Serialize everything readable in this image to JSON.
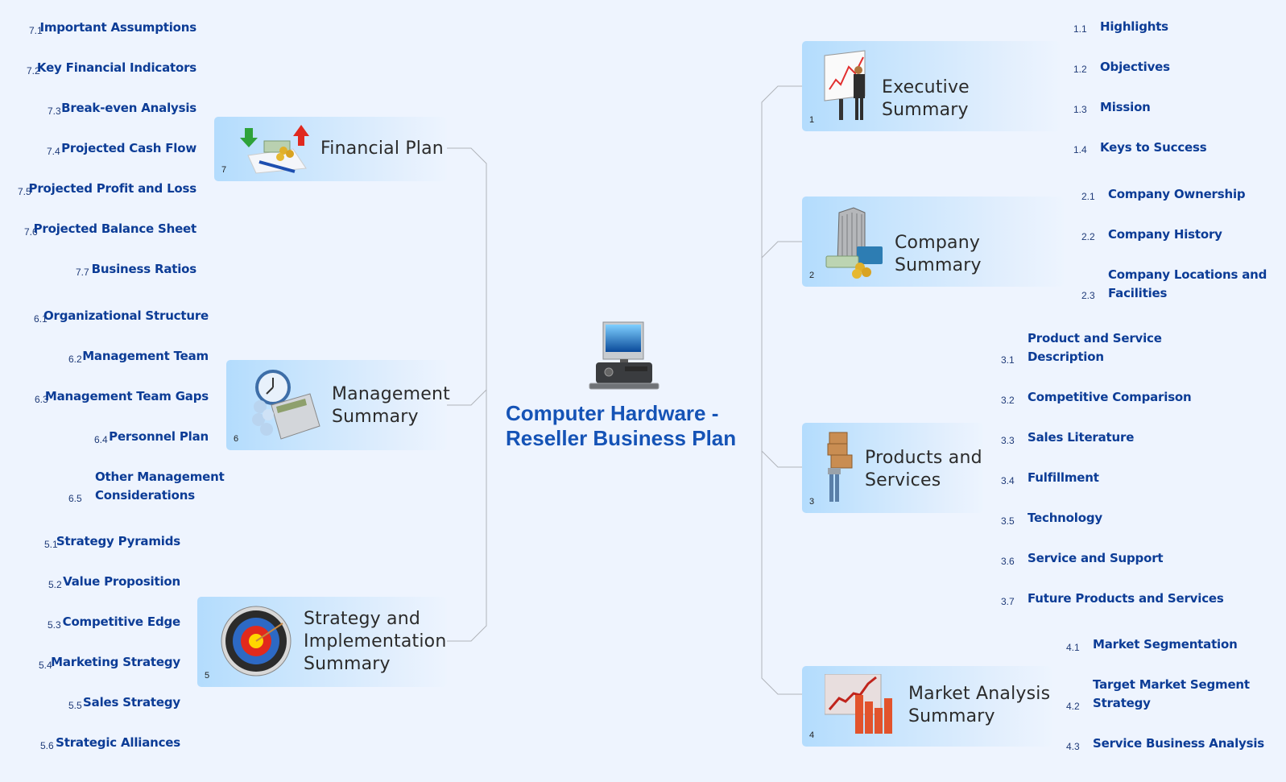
{
  "central": {
    "title_line1": "Computer Hardware -",
    "title_line2": "Reseller Business Plan",
    "icon": "desktop-computer-icon"
  },
  "colors": {
    "background": "#eef4fe",
    "node_fill": "#b3dcfd",
    "subtopic_text": "#0c3c96",
    "central_title": "#1553b6",
    "connector": "#b0b4ba"
  },
  "topics": [
    {
      "num": "1",
      "label_line1": "Executive Summary",
      "label_line2": "",
      "icon": "presenter-chart-icon",
      "subtopics": [
        {
          "num": "1.1",
          "line1": "Highlights",
          "line2": ""
        },
        {
          "num": "1.2",
          "line1": "Objectives",
          "line2": ""
        },
        {
          "num": "1.3",
          "line1": "Mission",
          "line2": ""
        },
        {
          "num": "1.4",
          "line1": "Keys to Success",
          "line2": ""
        }
      ]
    },
    {
      "num": "2",
      "label_line1": "Company Summary",
      "label_line2": "",
      "icon": "office-building-money-icon",
      "subtopics": [
        {
          "num": "2.1",
          "line1": "Company Ownership",
          "line2": ""
        },
        {
          "num": "2.2",
          "line1": "Company History",
          "line2": ""
        },
        {
          "num": "2.3",
          "line1": "Company Locations and",
          "line2": "Facilities"
        }
      ]
    },
    {
      "num": "3",
      "label_line1": "Products and",
      "label_line2": "Services",
      "icon": "person-carrying-boxes-icon",
      "subtopics": [
        {
          "num": "3.1",
          "line1": "Product and Service",
          "line2": "Description"
        },
        {
          "num": "3.2",
          "line1": "Competitive Comparison",
          "line2": ""
        },
        {
          "num": "3.3",
          "line1": "Sales Literature",
          "line2": ""
        },
        {
          "num": "3.4",
          "line1": "Fulfillment",
          "line2": ""
        },
        {
          "num": "3.5",
          "line1": "Technology",
          "line2": ""
        },
        {
          "num": "3.6",
          "line1": "Service and Support",
          "line2": ""
        },
        {
          "num": "3.7",
          "line1": "Future Products and Services",
          "line2": ""
        }
      ]
    },
    {
      "num": "4",
      "label_line1": "Market Analysis",
      "label_line2": "Summary",
      "icon": "growth-bar-chart-icon",
      "subtopics": [
        {
          "num": "4.1",
          "line1": "Market Segmentation",
          "line2": ""
        },
        {
          "num": "4.2",
          "line1": "Target Market Segment",
          "line2": "Strategy"
        },
        {
          "num": "4.3",
          "line1": "Service Business Analysis",
          "line2": ""
        }
      ]
    },
    {
      "num": "5",
      "label_line1": "Strategy and",
      "label_line2": "Implementation",
      "label_line3": "Summary",
      "icon": "target-bullseye-icon",
      "subtopics": [
        {
          "num": "5.1",
          "line1": "Strategy Pyramids",
          "line2": ""
        },
        {
          "num": "5.2",
          "line1": "Value Proposition",
          "line2": ""
        },
        {
          "num": "5.3",
          "line1": "Competitive Edge",
          "line2": ""
        },
        {
          "num": "5.4",
          "line1": "Marketing Strategy",
          "line2": ""
        },
        {
          "num": "5.5",
          "line1": "Sales Strategy",
          "line2": ""
        },
        {
          "num": "5.6",
          "line1": "Strategic Alliances",
          "line2": ""
        }
      ]
    },
    {
      "num": "6",
      "label_line1": "Management",
      "label_line2": "Summary",
      "icon": "calculator-clock-people-icon",
      "subtopics": [
        {
          "num": "6.1",
          "line1": "Organizational Structure",
          "line2": ""
        },
        {
          "num": "6.2",
          "line1": "Management Team",
          "line2": ""
        },
        {
          "num": "6.3",
          "line1": "Management Team Gaps",
          "line2": ""
        },
        {
          "num": "6.4",
          "line1": "Personnel Plan",
          "line2": ""
        },
        {
          "num": "6.5",
          "line1": "Other Management",
          "line2": "Considerations"
        }
      ]
    },
    {
      "num": "7",
      "label_line1": "Financial Plan",
      "label_line2": "",
      "icon": "money-arrows-pen-icon",
      "subtopics": [
        {
          "num": "7.1",
          "line1": "Important Assumptions",
          "line2": ""
        },
        {
          "num": "7.2",
          "line1": "Key Financial Indicators",
          "line2": ""
        },
        {
          "num": "7.3",
          "line1": "Break-even Analysis",
          "line2": ""
        },
        {
          "num": "7.4",
          "line1": "Projected Cash Flow",
          "line2": ""
        },
        {
          "num": "7.5",
          "line1": "Projected Profit and Loss",
          "line2": ""
        },
        {
          "num": "7.6",
          "line1": "Projected Balance Sheet",
          "line2": ""
        },
        {
          "num": "7.7",
          "line1": "Business Ratios",
          "line2": ""
        }
      ]
    }
  ]
}
